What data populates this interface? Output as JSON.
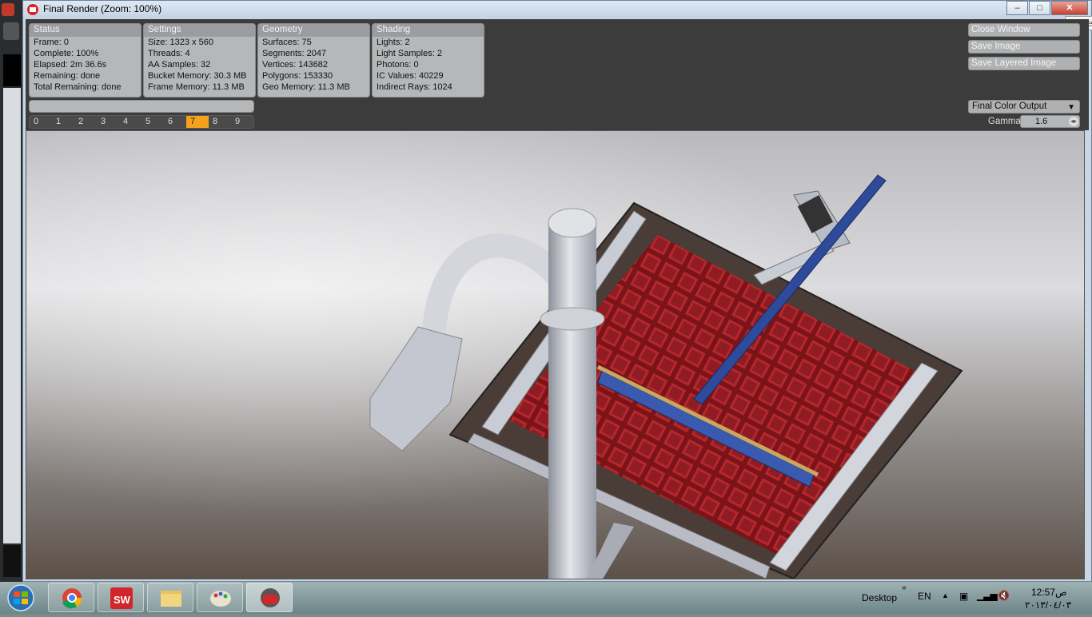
{
  "window": {
    "title": "Final Render (Zoom: 100%)",
    "close_tooltip": "Close"
  },
  "status": {
    "header": "Status",
    "rows": [
      "Frame: 0",
      "Complete: 100%",
      "Elapsed: 2m 36.6s",
      "Remaining: done",
      "Total Remaining: done"
    ]
  },
  "settings": {
    "header": "Settings",
    "rows": [
      "Size: 1323 x 560",
      "Threads: 4",
      "AA Samples: 32",
      "Bucket Memory: 30.3 MB",
      "Frame Memory: 11.3 MB"
    ]
  },
  "geometry": {
    "header": "Geometry",
    "rows": [
      "Surfaces: 75",
      "Segments: 2047",
      "Vertices: 143682",
      "Polygons: 153330",
      "Geo Memory: 11.3 MB"
    ]
  },
  "shading": {
    "header": "Shading",
    "rows": [
      "Lights: 2",
      "Light Samples: 2",
      "Photons: 0",
      "IC Values: 40229",
      "Indirect Rays: 1024"
    ]
  },
  "frames": {
    "items": [
      "0",
      "1",
      "2",
      "3",
      "4",
      "5",
      "6",
      "7",
      "8",
      "9"
    ],
    "active_index": 7
  },
  "buttons": {
    "close_window": "Close Window",
    "save_image": "Save Image",
    "save_layered": "Save Layered Image"
  },
  "output": {
    "selected": "Final Color Output",
    "gamma_label": "Gamma",
    "gamma_value": "1.6"
  },
  "taskbar": {
    "items": [
      "start-orb",
      "chrome",
      "solidworks",
      "file-explorer",
      "paint",
      "solidworks-render"
    ],
    "active_item": "solidworks-render",
    "desktop_label": "Desktop",
    "language": "EN",
    "time": "12:57",
    "ampm": "ص",
    "date": "٢٠١٣/٠٤/٠٣"
  },
  "colors": {
    "panel_bg": "#3c3c3c",
    "box_bg": "#b5b7b9",
    "active_frame": "#f4a21b",
    "grid_red": "#a8222a",
    "rail_blue": "#2e4a9a"
  }
}
